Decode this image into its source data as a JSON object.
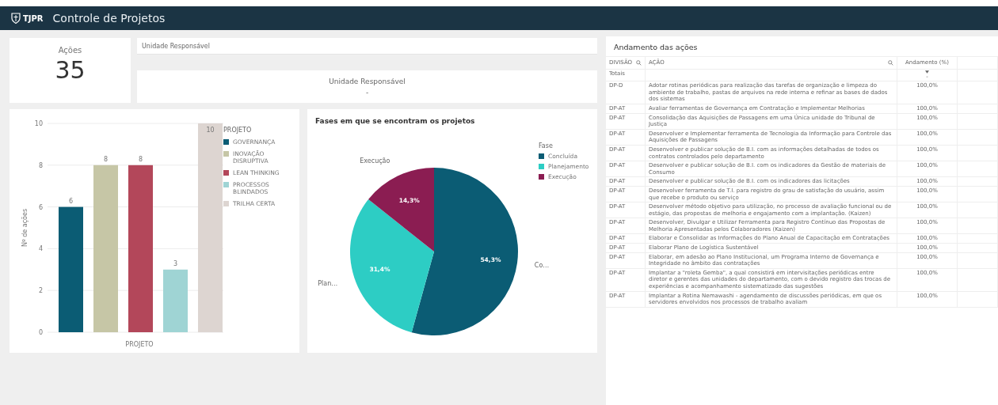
{
  "header": {
    "logo_text": "TJPR",
    "title": "Controle de Projetos"
  },
  "kpi": {
    "label": "Ações",
    "value": "35"
  },
  "filter": {
    "caption": "Unidade Responsável",
    "box_label": "Unidade Responsável",
    "box_value": "-"
  },
  "bar_chart": {
    "legend_title": "PROJETO",
    "chart_data": {
      "type": "bar",
      "xlabel": "PROJETO",
      "ylabel": "Nº de ações",
      "series": [
        {
          "name": "GOVERNANÇA",
          "color": "#0b5c74",
          "values": [
            6
          ]
        },
        {
          "name": "INOVAÇÃO DISRUPTIVA",
          "color": "#c6c6a6",
          "values": [
            8
          ]
        },
        {
          "name": "LEAN THINKING",
          "color": "#b3475a",
          "values": [
            8
          ]
        },
        {
          "name": "PROCESSOS BLINDADOS",
          "color": "#9fd4d4",
          "values": [
            3
          ]
        },
        {
          "name": "TRILHA CERTA",
          "color": "#ddd5d1",
          "values": [
            10
          ]
        }
      ],
      "ylim": [
        0,
        10
      ],
      "yticks": [
        0,
        2,
        4,
        6,
        8,
        10
      ],
      "grid": true,
      "data_labels": true
    }
  },
  "pie_chart": {
    "legend_title": "Fase",
    "slices": [
      {
        "color": "#0b5c74",
        "outside": "Co…"
      },
      {
        "color": "#2dcdc4",
        "outside": "Plan…"
      },
      {
        "color": "#8b1d52",
        "outside": "Execução"
      }
    ],
    "chart_data": {
      "type": "pie",
      "title": "Fases em que se encontram os projetos",
      "categories": [
        "Concluída",
        "Planejamento",
        "Execução"
      ],
      "values": [
        54.3,
        31.4,
        14.3
      ],
      "value_labels": [
        "54,3%",
        "31,4%",
        "14,3%"
      ]
    }
  },
  "table": {
    "title": "Andamento das ações",
    "columns": [
      "DIVISÃO",
      "AÇÃO",
      "Andamento (%)"
    ],
    "totals": {
      "label": "Totais",
      "value": "-"
    },
    "rows": [
      {
        "division": "DP-D",
        "action": "Adotar rotinas periódicas para realização das tarefas de organização e limpeza do ambiente de trabalho, pastas de arquivos na rede interna e refinar as bases de dados dos sistemas",
        "progress": "100,0%"
      },
      {
        "division": "DP-AT",
        "action": "Avaliar ferramentas de Governança em Contratação e Implementar Melhorias",
        "progress": "100,0%"
      },
      {
        "division": "DP-AT",
        "action": "Consolidação das Aquisições de Passagens em uma Única unidade do Tribunal de Justiça",
        "progress": "100,0%"
      },
      {
        "division": "DP-AT",
        "action": "Desenvolver e Implementar ferramenta de Tecnologia da Informação para Controle das Aquisições de Passagens",
        "progress": "100,0%"
      },
      {
        "division": "DP-AT",
        "action": "Desenvolver e publicar solução de B.I. com as informações detalhadas de todos os contratos controlados pelo departamento",
        "progress": "100,0%"
      },
      {
        "division": "DP-AT",
        "action": "Desenvolver e publicar solução de B.I. com os indicadores da Gestão de materiais de Consumo",
        "progress": "100,0%"
      },
      {
        "division": "DP-AT",
        "action": "Desenvolver e publicar solução de B.I. com os indicadores das licitações",
        "progress": "100,0%"
      },
      {
        "division": "DP-AT",
        "action": "Desenvolver ferramenta de T.I. para registro do grau de satisfação do usuário, assim que recebe o produto ou serviço",
        "progress": "100,0%"
      },
      {
        "division": "DP-AT",
        "action": "Desenvolver método objetivo para utilização, no processo de avaliação funcional ou de estágio, das propostas de melhoria e engajamento com a implantação. (Kaizen)",
        "progress": "100,0%"
      },
      {
        "division": "DP-AT",
        "action": "Desenvolver, Divulgar e Utilizar Ferramenta para Registro Contínuo das Propostas de Melhoria Apresentadas pelos Colaboradores (Kaizen)",
        "progress": "100,0%"
      },
      {
        "division": "DP-AT",
        "action": "Elaborar e Consolidar as Informações do Plano Anual de Capacitação em Contratações",
        "progress": "100,0%"
      },
      {
        "division": "DP-AT",
        "action": "Elaborar Plano de Logística Sustentável",
        "progress": "100,0%"
      },
      {
        "division": "DP-AT",
        "action": "Elaborar, em adesão ao Plano Institucional, um Programa Interno de Governança e Integridade no âmbito das contratações",
        "progress": "100,0%"
      },
      {
        "division": "DP-AT",
        "action": "Implantar a \"roleta Gemba\", a qual consistirá em intervisitações periódicas entre diretor e gerentes das unidades do departamento, com o devido registro das trocas de experiências e acompanhamento sistematizado das sugestões",
        "progress": "100,0%"
      },
      {
        "division": "DP-AT",
        "action": "Implantar a Rotina Nemawashi - agendamento de discussões periódicas, em que os servidores envolvidos nos processos de trabalho avaliam",
        "progress": "100,0%"
      }
    ]
  }
}
